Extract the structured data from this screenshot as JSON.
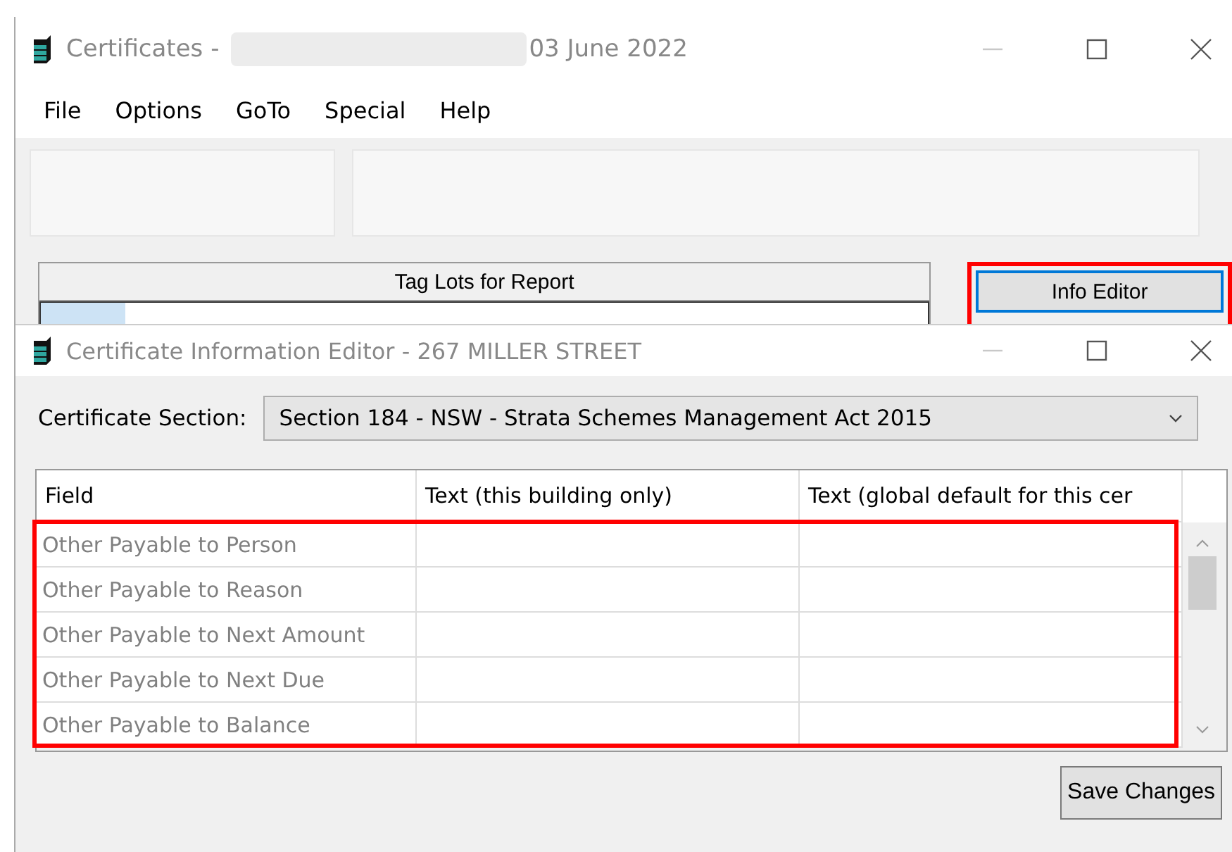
{
  "main_window": {
    "title": "Certificates -",
    "title_date": "03 June 2022",
    "menu": [
      "File",
      "Options",
      "GoTo",
      "Special",
      "Help"
    ],
    "tag_panel": {
      "title": "Tag Lots for Report"
    },
    "info_button": {
      "label": "Info Editor",
      "highlighted": true
    }
  },
  "editor_window": {
    "title": "Certificate Information Editor - 267 MILLER STREET",
    "section_label": "Certificate Section:",
    "section_value": "Section 184 - NSW - Strata Schemes Management Act 2015",
    "grid": {
      "highlighted": true,
      "columns": [
        "Field",
        "Text (this building only)",
        "Text (global default for this cer"
      ],
      "rows": [
        {
          "field": "Other Payable to Person"
        },
        {
          "field": "Other Payable to Reason"
        },
        {
          "field": "Other Payable to Next Amount"
        },
        {
          "field": "Other Payable to Next Due"
        },
        {
          "field": "Other Payable to Balance"
        }
      ]
    },
    "save_button": "Save Changes"
  }
}
